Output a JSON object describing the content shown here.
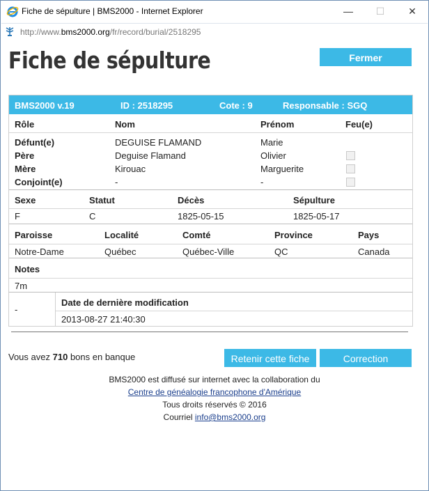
{
  "window": {
    "title": "Fiche de sépulture | BMS2000 - Internet Explorer",
    "minimize": "—",
    "maximize": "☐",
    "close": "✕",
    "url_prefix": "http://www.",
    "url_domain": "bms2000.org",
    "url_path": "/fr/record/burial/2518295"
  },
  "page": {
    "title": "Fiche de sépulture",
    "close_button": "Fermer"
  },
  "record": {
    "header": {
      "version": "BMS2000 v.19",
      "id": "ID : 2518295",
      "cote": "Cote : 9",
      "responsable": "Responsable : SGQ"
    },
    "persons": {
      "columns": [
        "Rôle",
        "Nom",
        "Prénom",
        "Feu(e)"
      ],
      "rows": [
        {
          "role": "Défunt(e)",
          "nom": "DEGUISE FLAMAND",
          "prenom": "Marie",
          "feu": null
        },
        {
          "role": "Père",
          "nom": "Deguise Flamand",
          "prenom": "Olivier",
          "feu": false
        },
        {
          "role": "Mère",
          "nom": "Kirouac",
          "prenom": "Marguerite",
          "feu": false
        },
        {
          "role": "Conjoint(e)",
          "nom": "-",
          "prenom": "-",
          "feu": false
        }
      ]
    },
    "vital": {
      "columns": [
        "Sexe",
        "Statut",
        "Décès",
        "Sépulture"
      ],
      "values": [
        "F",
        "C",
        "1825-05-15",
        "1825-05-17"
      ]
    },
    "place": {
      "columns": [
        "Paroisse",
        "Localité",
        "Comté",
        "Province",
        "Pays"
      ],
      "values": [
        "Notre-Dame",
        "Québec",
        "Québec-Ville",
        "QC",
        "Canada"
      ]
    },
    "notes": {
      "label": "Notes",
      "value": "7m"
    },
    "modification": {
      "left_value": "-",
      "label": "Date de dernière modification",
      "value": "2013-08-27 21:40:30"
    }
  },
  "bank": {
    "prefix": "Vous avez",
    "count": "710",
    "suffix": "bons en banque"
  },
  "actions": {
    "retain": "Retenir cette fiche",
    "correction": "Correction"
  },
  "footer": {
    "line1": "BMS2000 est diffusé sur internet avec la collaboration du",
    "link1": "Centre de généalogie francophone d'Amérique",
    "line3": "Tous droits réservés © 2016",
    "line4_prefix": "Courriel",
    "email": "info@bms2000.org"
  },
  "colors": {
    "accent": "#3cb9e6",
    "link": "#1a3e8c"
  }
}
